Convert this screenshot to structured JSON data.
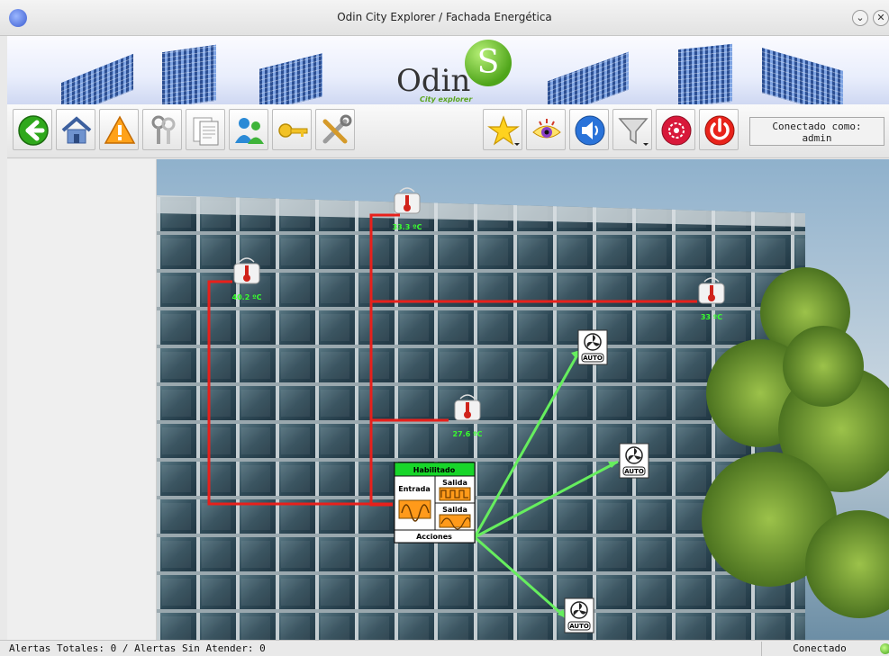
{
  "window": {
    "title": "Odin City Explorer / Fachada Energética",
    "minimize_glyph": "⌄",
    "close_glyph": "✕"
  },
  "banner": {
    "logo_text": "Odin",
    "logo_letter": "S",
    "logo_sub": "City explorer"
  },
  "toolbar": {
    "left_icons": [
      "back-arrow-icon",
      "home-icon",
      "warning-icon",
      "keys-icon",
      "documents-icon",
      "users-icon",
      "key-icon",
      "tools-icon"
    ],
    "right_icons": [
      "favorites-star-icon",
      "eye-icon",
      "audio-icon",
      "filter-icon",
      "alarm-icon",
      "power-icon"
    ],
    "connected_as_label": "Conectado como:",
    "connected_user": "admin"
  },
  "scene": {
    "sensors": [
      {
        "name": "thermometer-sensor-top",
        "temperature": "33.3 ºC"
      },
      {
        "name": "thermometer-sensor-left",
        "temperature": "40.2 ºC"
      },
      {
        "name": "thermometer-sensor-right",
        "temperature": "33 ºC"
      },
      {
        "name": "thermometer-sensor-middle",
        "temperature": "27.6 ºC"
      }
    ],
    "controller": {
      "status": "Habilitado",
      "input_label": "Entrada",
      "output1_label": "Salida",
      "output2_label": "Salida",
      "actions_label": "Acciones"
    },
    "fans": [
      {
        "name": "fan-top",
        "mode": "AUTO"
      },
      {
        "name": "fan-middle",
        "mode": "AUTO"
      },
      {
        "name": "fan-bottom",
        "mode": "AUTO"
      }
    ],
    "colors": {
      "wire_red": "#e8201b",
      "wire_green": "#66ee5e",
      "enabled_green": "#18d62a",
      "wave_orange": "#ff9a1a"
    }
  },
  "statusbar": {
    "alerts_text": "Alertas Totales: 0 / Alertas Sin Atender: 0",
    "connection_status": "Conectado"
  }
}
